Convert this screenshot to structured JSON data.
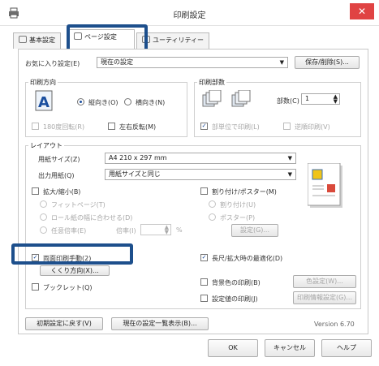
{
  "window": {
    "title": "印刷設定",
    "close_symbol": "✕"
  },
  "tabs": [
    {
      "label": "基本設定",
      "icon": "main-tab-icon"
    },
    {
      "label": "ページ設定",
      "icon": "page-tab-icon"
    },
    {
      "label": "ユーティリティー",
      "icon": "utility-tab-icon"
    }
  ],
  "preset": {
    "label": "お気に入り設定(E)",
    "value": "現在の設定",
    "save_button": "保存/削除(S)..."
  },
  "orientation": {
    "title": "印刷方向",
    "portrait": "縦向き(O)",
    "landscape": "横向き(N)",
    "rotate180": "180度回転(R)",
    "mirror": "左右反転(M)"
  },
  "copies_group": {
    "title": "印刷部数",
    "copies_label": "部数(C)",
    "copies_value": "1",
    "collate": "部単位で印刷(L)",
    "reverse": "逆順印刷(V)"
  },
  "layout": {
    "title": "レイアウト",
    "paper_size_label": "用紙サイズ(Z)",
    "paper_size_value": "A4 210 x 297 mm",
    "output_paper_label": "出力用紙(Q)",
    "output_paper_value": "用紙サイズと同じ",
    "zoom": "拡大/縮小(B)",
    "fit_page": "フィットページ(T)",
    "fit_roll": "ロール紙の幅に合わせる(D)",
    "custom_zoom": "任意倍率(E)",
    "zoom_ratio_label": "倍率(I)",
    "zoom_unit": "%",
    "multipage": "割り付け/ポスター(M)",
    "nup": "割り付け(U)",
    "poster": "ポスター(P)",
    "setting_button": "設定(G)...",
    "duplex": "両面印刷手動(2)",
    "duplex_settings_button": "くくり方向(X)...",
    "folded_booklet": "ブックレット(Q)",
    "longest_edge": "長尺/拡大時の最適化(D)",
    "watermark": "背景色の印刷(B)",
    "watermark_button": "色設定(W)...",
    "print_info": "設定値の印刷(J)",
    "print_info_button": "印刷情報設定(G)..."
  },
  "bottom": {
    "restore_defaults": "初期設定に戻す(V)",
    "show_settings": "現在の設定一覧表示(B)...",
    "version": "Version 6.70"
  },
  "footer": {
    "ok": "OK",
    "cancel": "キャンセル",
    "help": "ヘルプ"
  },
  "colors": {
    "highlight": "#1d4f8c",
    "close": "#e04343",
    "accent": "#1b4f9f"
  }
}
